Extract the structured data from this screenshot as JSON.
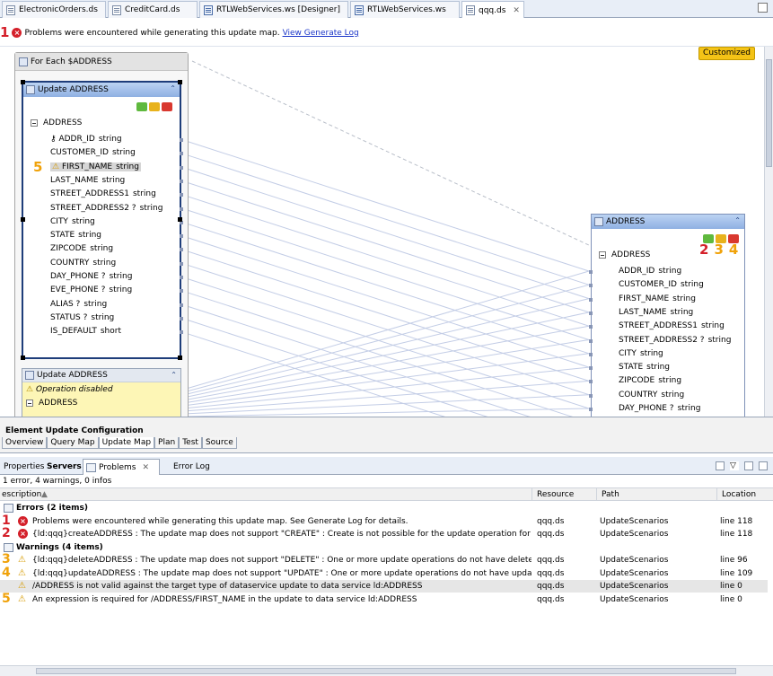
{
  "editor_tabs": [
    {
      "label": "ElectronicOrders.ds",
      "icon": "ds-file-icon"
    },
    {
      "label": "CreditCard.ds",
      "icon": "ds-file-icon"
    },
    {
      "label": "RTLWebServices.ws [Designer]",
      "icon": "ws-file-icon"
    },
    {
      "label": "RTLWebServices.ws",
      "icon": "ws-file-icon"
    },
    {
      "label": "qqq.ds",
      "icon": "ds-file-icon",
      "active": true,
      "close": "✕"
    }
  ],
  "error_bar": {
    "marker": "1",
    "message": "Problems were encountered while generating this update map.",
    "link": "View Generate Log"
  },
  "canvas": {
    "customized_badge": "Customized",
    "foreach_title": "For Each $ADDRESS",
    "update_box": {
      "title": "Update ADDRESS",
      "root": "ADDRESS",
      "marker": "5",
      "fields": [
        {
          "name": "ADDR_ID",
          "type": "string",
          "key": true
        },
        {
          "name": "CUSTOMER_ID",
          "type": "string"
        },
        {
          "name": "FIRST_NAME",
          "type": "string",
          "warning": true
        },
        {
          "name": "LAST_NAME",
          "type": "string"
        },
        {
          "name": "STREET_ADDRESS1",
          "type": "string"
        },
        {
          "name": "STREET_ADDRESS2 ?",
          "type": "string"
        },
        {
          "name": "CITY",
          "type": "string"
        },
        {
          "name": "STATE",
          "type": "string"
        },
        {
          "name": "ZIPCODE",
          "type": "string"
        },
        {
          "name": "COUNTRY",
          "type": "string"
        },
        {
          "name": "DAY_PHONE ?",
          "type": "string"
        },
        {
          "name": "EVE_PHONE ?",
          "type": "string"
        },
        {
          "name": "ALIAS ?",
          "type": "string"
        },
        {
          "name": "STATUS ?",
          "type": "string"
        },
        {
          "name": "IS_DEFAULT",
          "type": "short"
        }
      ]
    },
    "update_box_2": {
      "title": "Update ADDRESS",
      "notice": "Operation disabled",
      "root": "ADDRESS"
    },
    "address_box": {
      "title": "ADDRESS",
      "root": "ADDRESS",
      "markers": [
        "2",
        "3",
        "4"
      ],
      "fields": [
        {
          "name": "ADDR_ID",
          "type": "string"
        },
        {
          "name": "CUSTOMER_ID",
          "type": "string"
        },
        {
          "name": "FIRST_NAME",
          "type": "string"
        },
        {
          "name": "LAST_NAME",
          "type": "string"
        },
        {
          "name": "STREET_ADDRESS1",
          "type": "string"
        },
        {
          "name": "STREET_ADDRESS2 ?",
          "type": "string"
        },
        {
          "name": "CITY",
          "type": "string"
        },
        {
          "name": "STATE",
          "type": "string"
        },
        {
          "name": "ZIPCODE",
          "type": "string"
        },
        {
          "name": "COUNTRY",
          "type": "string"
        },
        {
          "name": "DAY_PHONE ?",
          "type": "string"
        }
      ]
    }
  },
  "config": {
    "title": "Element Update Configuration",
    "tabs": [
      "Overview",
      "Query Map",
      "Update Map",
      "Plan",
      "Test",
      "Source"
    ],
    "active_tab": "Update Map"
  },
  "problems_view": {
    "tabs": [
      {
        "label": "Properties"
      },
      {
        "label": "Servers",
        "bold": true
      },
      {
        "label": "Problems",
        "close": "✕",
        "active": true
      },
      {
        "label": "Error Log"
      }
    ],
    "summary": "1 error, 4 warnings, 0 infos",
    "columns": {
      "description": "escription",
      "resource": "Resource",
      "path": "Path",
      "location": "Location"
    },
    "groups": [
      {
        "label": "Errors (2 items)",
        "rows": [
          {
            "marker": "1",
            "icon": "error",
            "description": "Problems were encountered while generating this update map. See Generate Log for details.",
            "resource": "qqq.ds",
            "path": "UpdateScenarios",
            "location": "line 118"
          },
          {
            "marker": "2",
            "icon": "error",
            "description": "{ld:qqq}createADDRESS : The update map does not support \"CREATE\" : Create is not possible for the update operation for ld:ADDRESS.",
            "resource": "qqq.ds",
            "path": "UpdateScenarios",
            "location": "line 118"
          }
        ]
      },
      {
        "label": "Warnings (4 items)",
        "rows": [
          {
            "marker": "3",
            "icon": "warning",
            "description": "{ld:qqq}deleteADDRESS : The update map does not support \"DELETE\" : One or more update operations do not have delete capabilities.",
            "resource": "qqq.ds",
            "path": "UpdateScenarios",
            "location": "line 96"
          },
          {
            "marker": "4",
            "icon": "warning",
            "description": "{ld:qqq}updateADDRESS : The update map does not support \"UPDATE\" : One or more update operations do not have update capabilities.",
            "resource": "qqq.ds",
            "path": "UpdateScenarios",
            "location": "line 109"
          },
          {
            "marker": "",
            "icon": "warning",
            "description": "/ADDRESS is not valid against the target type of dataservice update to data service ld:ADDRESS",
            "resource": "qqq.ds",
            "path": "UpdateScenarios",
            "location": "line 0",
            "highlighted": true
          },
          {
            "marker": "5",
            "icon": "warning",
            "description": "An expression is required for /ADDRESS/FIRST_NAME in the update to data service ld:ADDRESS",
            "resource": "qqq.ds",
            "path": "UpdateScenarios",
            "location": "line 0"
          }
        ]
      }
    ]
  },
  "colors": {
    "error": "#d4202a",
    "warning": "#f2c12e",
    "marker_orange": "#f0a20a",
    "selection_blue": "#1e3d7a",
    "link": "#1a35c9",
    "mapping_line": "#c3cde6"
  }
}
